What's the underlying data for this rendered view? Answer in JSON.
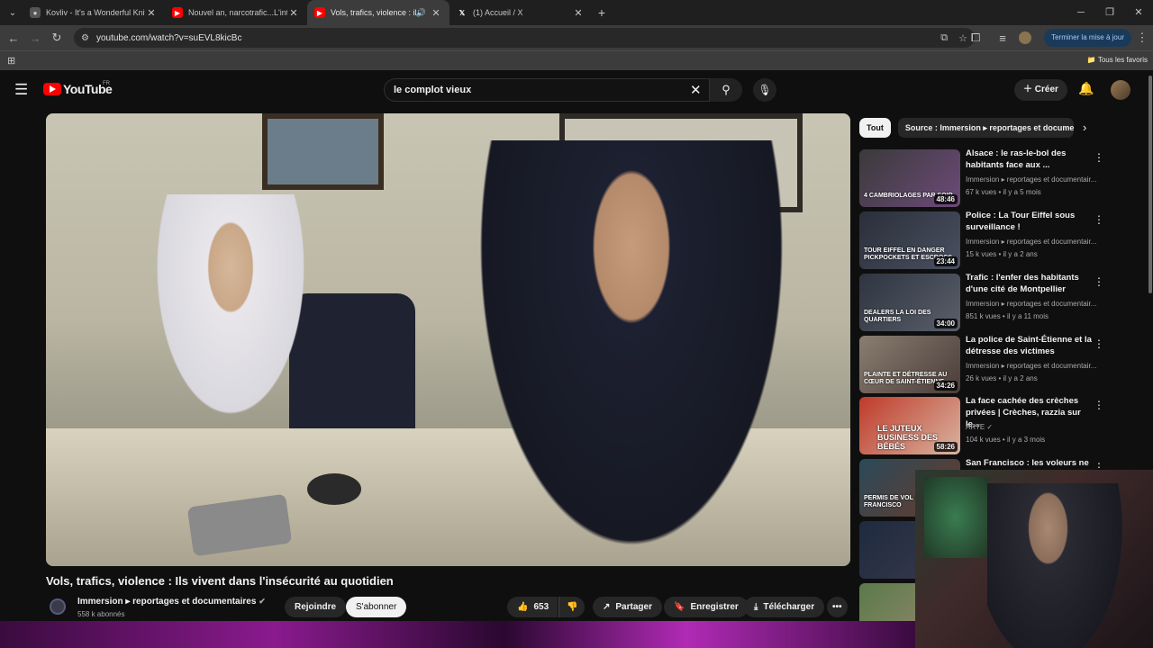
{
  "browser": {
    "tabs": [
      {
        "title": "Kovliv - It's a Wonderful Knife (",
        "favicon": "globe-icon",
        "active": false
      },
      {
        "title": "Nouvel an, narcotrafic...L'interv",
        "favicon": "youtube-icon",
        "active": false
      },
      {
        "title": "Vols, trafics, violence : ils vi",
        "favicon": "youtube-icon",
        "active": true,
        "audio": true
      },
      {
        "title": "(1) Accueil / X",
        "favicon": "x-icon",
        "active": false
      }
    ],
    "url": "youtube.com/watch?v=suEVL8kicBc",
    "update_label": "Terminer la mise à jour",
    "bookmarks_label": "Tous les favoris"
  },
  "youtube": {
    "logo_text": "YouTube",
    "region": "FR",
    "search_value": "le complot vieux",
    "create_label": "Créer"
  },
  "video": {
    "title": "Vols, trafics, violence : Ils vivent dans l'insécurité au quotidien",
    "channel": "Immersion ▸ reportages et documentaires",
    "subscribers": "558 k abonnés",
    "join_label": "Rejoindre",
    "subscribe_label": "S'abonner",
    "likes": "653",
    "share_label": "Partager",
    "save_label": "Enregistrer",
    "download_label": "Télécharger"
  },
  "sidebar": {
    "chips": [
      "Tout",
      "Source : Immersion ▸ reportages et docume"
    ],
    "recommendations": [
      {
        "title": "Alsace : le ras-le-bol des habitants face aux ...",
        "channel": "Immersion ▸ reportages et documentair...",
        "meta": "67 k vues • il y a 5 mois",
        "duration": "48:46",
        "caption": "4 CAMBRIOLAGES PAR SOIR",
        "color": "#6d4a7a"
      },
      {
        "title": "Police : La Tour Eiffel sous surveillance !",
        "channel": "Immersion ▸ reportages et documentair...",
        "meta": "15 k vues • il y a 2 ans",
        "duration": "23:44",
        "caption": "TOUR EIFFEL EN DANGER PICKPOCKETS ET ESCROCS",
        "color": "#4a5060"
      },
      {
        "title": "Trafic : l'enfer des habitants d'une cité de Montpellier",
        "channel": "Immersion ▸ reportages et documentair...",
        "meta": "851 k vues • il y a 11 mois",
        "duration": "34:00",
        "caption": "DEALERS LA LOI DES QUARTIERS",
        "color": "#5a5f6a"
      },
      {
        "title": "La police de Saint-Étienne et la détresse des victimes",
        "channel": "Immersion ▸ reportages et documentair...",
        "meta": "26 k vues • il y a 2 ans",
        "duration": "34:26",
        "caption": "PLAINTE ET DÉTRESSE AU CŒUR DE SAINT-ÉTIENNE",
        "color": "#7a6a60"
      },
      {
        "title": "La face cachée des crèches privées | Crèches, razzia sur le...",
        "channel": "ARTE ✓",
        "meta": "104 k vues • il y a 3 mois",
        "duration": "58:26",
        "caption": "LE JUTEUX BUSINESS DES BÉBÉS",
        "color": "#b04030"
      },
      {
        "title": "San Francisco : les voleurs ne",
        "channel": "",
        "meta": "",
        "duration": "",
        "caption": "PERMIS DE VOL À SAN FRANCISCO",
        "color": "#3a5a6a"
      }
    ]
  }
}
